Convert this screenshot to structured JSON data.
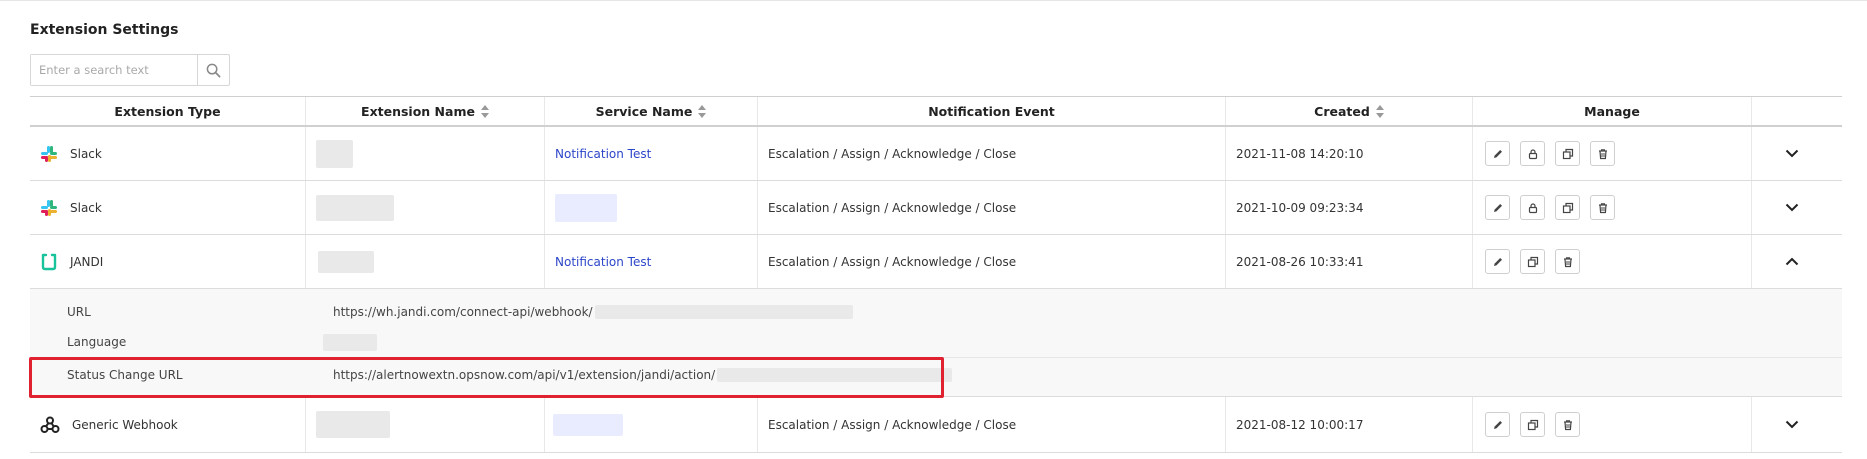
{
  "page": {
    "title": "Extension Settings"
  },
  "search": {
    "placeholder": "Enter a search text"
  },
  "table": {
    "headers": {
      "extension_type": "Extension Type",
      "extension_name": "Extension Name",
      "service_name": "Service Name",
      "notification_event": "Notification Event",
      "created": "Created",
      "manage": "Manage"
    },
    "rows": [
      {
        "type": "Slack",
        "service": "Notification Test",
        "event": "Escalation / Assign / Acknowledge / Close",
        "created": "2021-11-08 14:20:10",
        "icon": "slack-icon"
      },
      {
        "type": "Slack",
        "service": "",
        "event": "Escalation / Assign / Acknowledge / Close",
        "created": "2021-10-09 09:23:34",
        "icon": "slack-icon"
      },
      {
        "type": "JANDI",
        "service": "Notification Test",
        "event": "Escalation / Assign / Acknowledge / Close",
        "created": "2021-08-26 10:33:41",
        "icon": "jandi-icon"
      },
      {
        "type": "Generic Webhook",
        "service": "",
        "event": "Escalation / Assign / Acknowledge / Close",
        "created": "2021-08-12 10:00:17",
        "icon": "webhook-icon"
      }
    ],
    "detail": {
      "url_label": "URL",
      "url_value": "https://wh.jandi.com/connect-api/webhook/",
      "language_label": "Language",
      "status_url_label": "Status Change URL",
      "status_url_value": "https://alertnowextn.opsnow.com/api/v1/extension/jandi/action/"
    }
  },
  "colors": {
    "link": "#2d46c9",
    "highlight": "#e0212f",
    "jandi": "#17c39a"
  }
}
